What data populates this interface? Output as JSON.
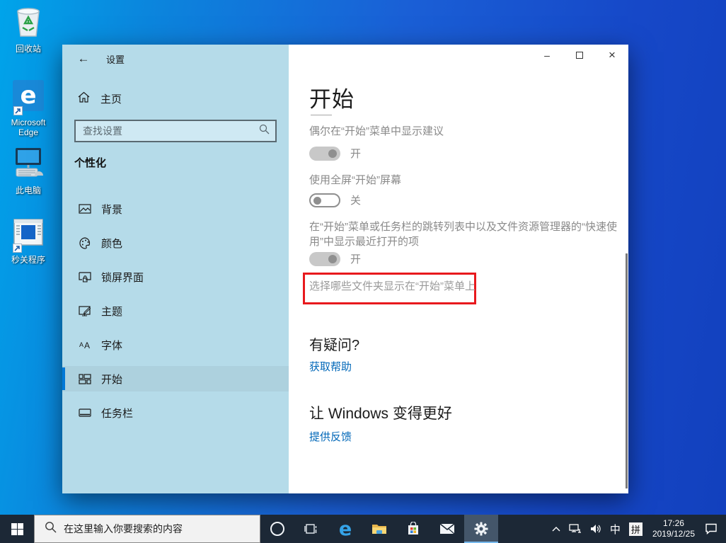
{
  "desktop": {
    "icons": [
      {
        "name": "recycle-bin",
        "label": "回收站"
      },
      {
        "name": "microsoft-edge",
        "label": "Microsoft Edge"
      },
      {
        "name": "this-pc",
        "label": "此电脑"
      },
      {
        "name": "app-shortcut",
        "label": "秒关程序"
      }
    ]
  },
  "window": {
    "titlebar": {
      "back": "←",
      "title": "设置"
    },
    "controls": {
      "minimize": "–",
      "maximize": "❐",
      "close": "×"
    },
    "sidebar": {
      "home_label": "主页",
      "search_placeholder": "查找设置",
      "section": "个性化",
      "items": [
        {
          "label": "背景"
        },
        {
          "label": "颜色"
        },
        {
          "label": "锁屏界面"
        },
        {
          "label": "主题"
        },
        {
          "label": "字体"
        },
        {
          "label": "开始",
          "selected": true
        },
        {
          "label": "任务栏"
        }
      ]
    },
    "main": {
      "title": "开始",
      "settings": [
        {
          "label": "偶尔在“开始”菜单中显示建议",
          "state": "开",
          "on": true
        },
        {
          "label": "使用全屏“开始”屏幕",
          "state": "关",
          "on": false
        },
        {
          "label": "在“开始”菜单或任务栏的跳转列表中以及文件资源管理器的“快速使用”中显示最近打开的项",
          "state": "开",
          "on": true
        }
      ],
      "folders_link": "选择哪些文件夹显示在“开始”菜单上",
      "help_heading": "有疑问?",
      "help_link": "获取帮助",
      "feedback_heading": "让 Windows 变得更好",
      "feedback_link": "提供反馈"
    }
  },
  "taskbar": {
    "search_placeholder": "在这里输入你要搜索的内容",
    "tray": {
      "ime": "中",
      "ime_mode": "拼",
      "time": "17:26",
      "date": "2019/12/25"
    }
  },
  "colors": {
    "link_blue": "#0067b8",
    "annotation_red": "#e8191d",
    "accent": "#0078d7",
    "sidebar_bg": "#b5dbe9",
    "taskbar_bg": "#1c2836"
  }
}
